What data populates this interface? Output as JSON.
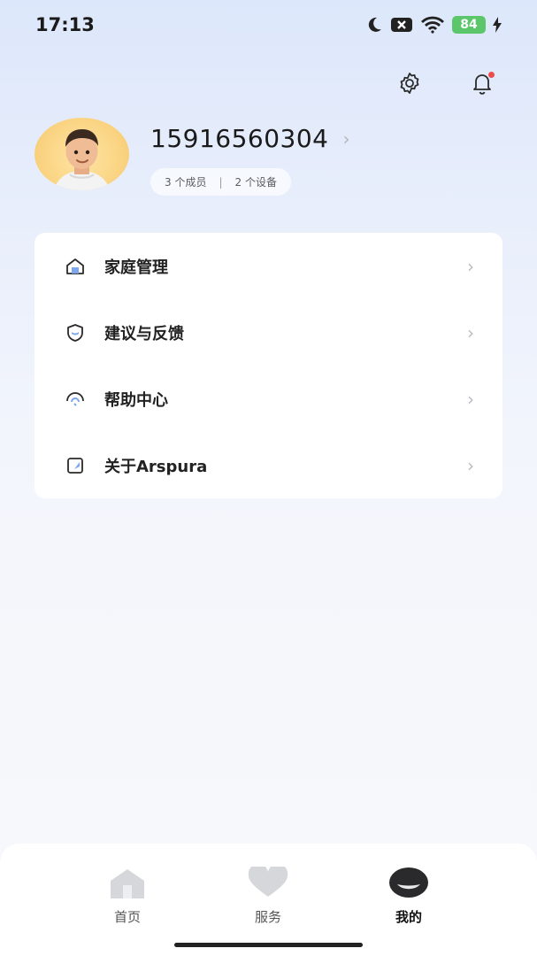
{
  "status_bar": {
    "time": "17:13",
    "battery": "84"
  },
  "top_actions": {
    "settings_icon": "gear-icon",
    "notification_icon": "bell-icon",
    "notification_badge": true
  },
  "profile": {
    "phone": "15916560304",
    "members": "3 个成员",
    "separator": "|",
    "devices": "2 个设备"
  },
  "menu": {
    "items": [
      {
        "label": "家庭管理",
        "icon": "home-icon"
      },
      {
        "label": "建议与反馈",
        "icon": "shield-icon"
      },
      {
        "label": "帮助中心",
        "icon": "headset-icon"
      },
      {
        "label": "关于Arspura",
        "icon": "info-book-icon"
      }
    ]
  },
  "tabbar": {
    "tabs": [
      {
        "label": "首页",
        "icon": "home-tab-icon",
        "active": false
      },
      {
        "label": "服务",
        "icon": "heart-tab-icon",
        "active": false
      },
      {
        "label": "我的",
        "icon": "profile-tab-icon",
        "active": true
      }
    ]
  },
  "colors": {
    "accent_blue": "#5b8def",
    "badge_red": "#ee4c4c",
    "battery_green": "#5cc66a"
  }
}
